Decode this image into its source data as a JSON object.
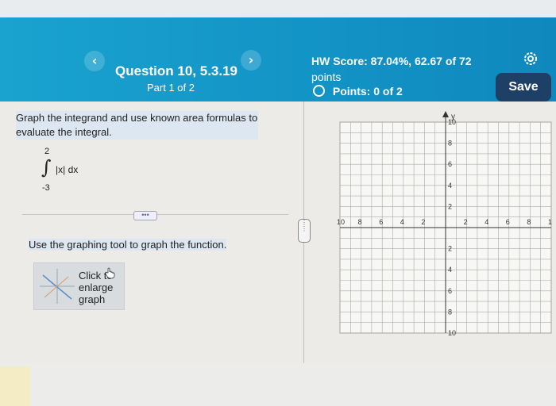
{
  "header": {
    "question_title": "Question 10, 5.3.19",
    "question_part": "Part 1 of 2",
    "prev_icon": "chevron-left-icon",
    "next_icon": "chevron-right-icon",
    "hw_score_line1": "HW Score: 87.04%, 62.67 of 72",
    "hw_score_line2": "points",
    "points_text": "Points: 0 of 2",
    "settings_icon": "gear-icon",
    "save_label": "Save"
  },
  "problem": {
    "instruction": "Graph the integrand and use known area formulas to evaluate the integral.",
    "integral": {
      "upper_limit": "2",
      "lower_limit": "-3",
      "integrand": "|x| dx"
    },
    "tool_instruction": "Use the graphing tool to graph the function.",
    "enlarge_label": "Click to enlarge graph"
  },
  "graph": {
    "x_ticks": [
      "10",
      "8",
      "6",
      "4",
      "2",
      "2",
      "4",
      "6",
      "8",
      "1"
    ],
    "y_ticks": [
      "10",
      "8",
      "6",
      "4",
      "2",
      "2",
      "4",
      "6",
      "8",
      "10"
    ],
    "y_axis_label": "y"
  }
}
